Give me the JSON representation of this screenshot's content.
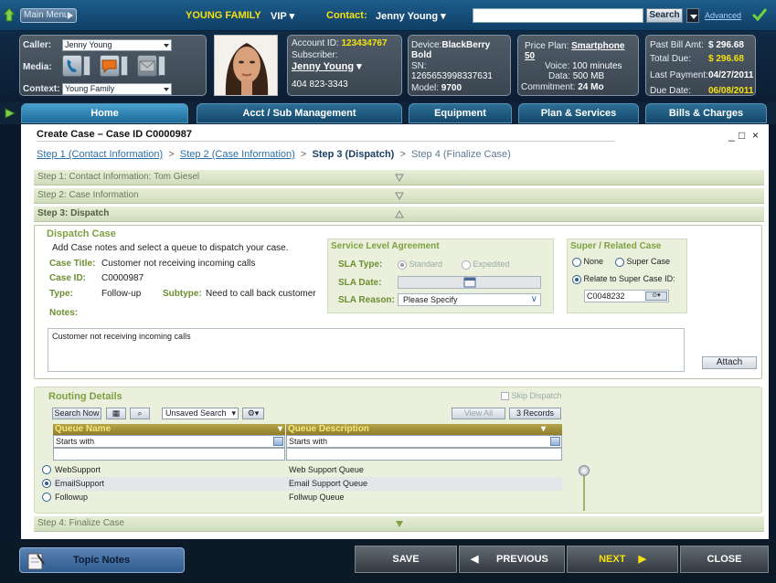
{
  "topbar": {
    "main_menu": "Main Menu",
    "family": "YOUNG FAMILY",
    "vip": "VIP",
    "contact_label": "Contact:",
    "contact_name": "Jenny Young",
    "search_placeholder": "",
    "search_button": "Search",
    "advanced": "Advanced"
  },
  "caller": {
    "caller_label": "Caller:",
    "caller_value": "Jenny Young",
    "media_label": "Media:",
    "context_label": "Context:",
    "context_value": "Young Family"
  },
  "account": {
    "account_id_label": "Account ID:",
    "account_id": "123434767",
    "subscriber_label": "Subscriber:",
    "subscriber": "Jenny Young",
    "phone": "404 823-3343"
  },
  "device": {
    "device_label": "Device:",
    "device": "BlackBerry Bold",
    "sn_label": "SN:",
    "sn": "1265653998337631",
    "model_label": "Model:",
    "model": "9700"
  },
  "plan": {
    "price_plan_label": "Price Plan:",
    "price_plan": "Smartphone 50",
    "voice_label": "Voice:",
    "voice": "100 minutes",
    "data_label": "Data:",
    "data": "500 MB",
    "commitment_label": "Commitment:",
    "commitment": "24 Mo"
  },
  "billing": {
    "past_bill_label": "Past Bill Amt:",
    "past_bill": "$ 296.68",
    "total_due_label": "Total Due:",
    "total_due": "$ 296.68",
    "last_payment_label": "Last Payment:",
    "last_payment": "04/27/2011",
    "due_date_label": "Due Date:",
    "due_date": "06/08/2011"
  },
  "nav_tabs": [
    "Home",
    "Acct / Sub Management",
    "Equipment",
    "Plan & Services",
    "Bills & Charges"
  ],
  "case": {
    "title": "Create Case – Case ID C0000987",
    "breadcrumb": [
      "Step 1 (Contact Information)",
      "Step 2 (Case Information)",
      "Step 3 (Dispatch)",
      "Step 4 (Finalize Case)"
    ],
    "step1": "Step 1: Contact Information: Tom Giesel",
    "step2": "Step 2: Case Information",
    "step3": "Step 3: Dispatch",
    "step4": "Step 4: Finalize Case"
  },
  "dispatch": {
    "title": "Dispatch Case",
    "instructions": "Add Case notes and select a queue to dispatch your case.",
    "case_title_label": "Case Title:",
    "case_title": "Customer not receiving incoming calls",
    "case_id_label": "Case ID:",
    "case_id": "C0000987",
    "type_label": "Type:",
    "type": "Follow-up",
    "subtype_label": "Subtype:",
    "subtype": "Need to call back customer",
    "notes_label": "Notes:",
    "notes_value": "Customer not receiving incoming calls",
    "attach": "Attach"
  },
  "sla": {
    "title": "Service Level Agreement",
    "type_label": "SLA Type:",
    "standard": "Standard",
    "expedited": "Expedited",
    "date_label": "SLA Date:",
    "reason_label": "SLA Reason:",
    "reason_value": "Please Specify"
  },
  "super_case": {
    "title": "Super / Related Case",
    "none": "None",
    "super": "Super Case",
    "relate": "Relate to Super Case ID:",
    "case_id_value": "C0048232"
  },
  "routing": {
    "title": "Routing Details",
    "skip_dispatch": "Skip Dispatch",
    "search_now": "Search Now",
    "saved_search": "Unsaved Search",
    "view_all": "View All",
    "records": "3 Records",
    "col_queue_name": "Queue Name",
    "col_queue_desc": "Queue Description",
    "filter_1": "Starts with",
    "filter_2": "Starts with",
    "rows": [
      {
        "name": "WebSupport",
        "desc": "Web Support Queue",
        "selected": false
      },
      {
        "name": "EmailSupport",
        "desc": "Email Support Queue",
        "selected": true
      },
      {
        "name": "Followup",
        "desc": "Follwup Queue",
        "selected": false
      }
    ]
  },
  "bottom": {
    "topic_notes": "Topic Notes",
    "save": "SAVE",
    "previous": "PREVIOUS",
    "next": "NEXT",
    "close": "CLOSE"
  },
  "colors": {
    "accent_yellow": "#f5e10f",
    "section_green": "#7ea142",
    "nav_blue": "#15476b"
  }
}
